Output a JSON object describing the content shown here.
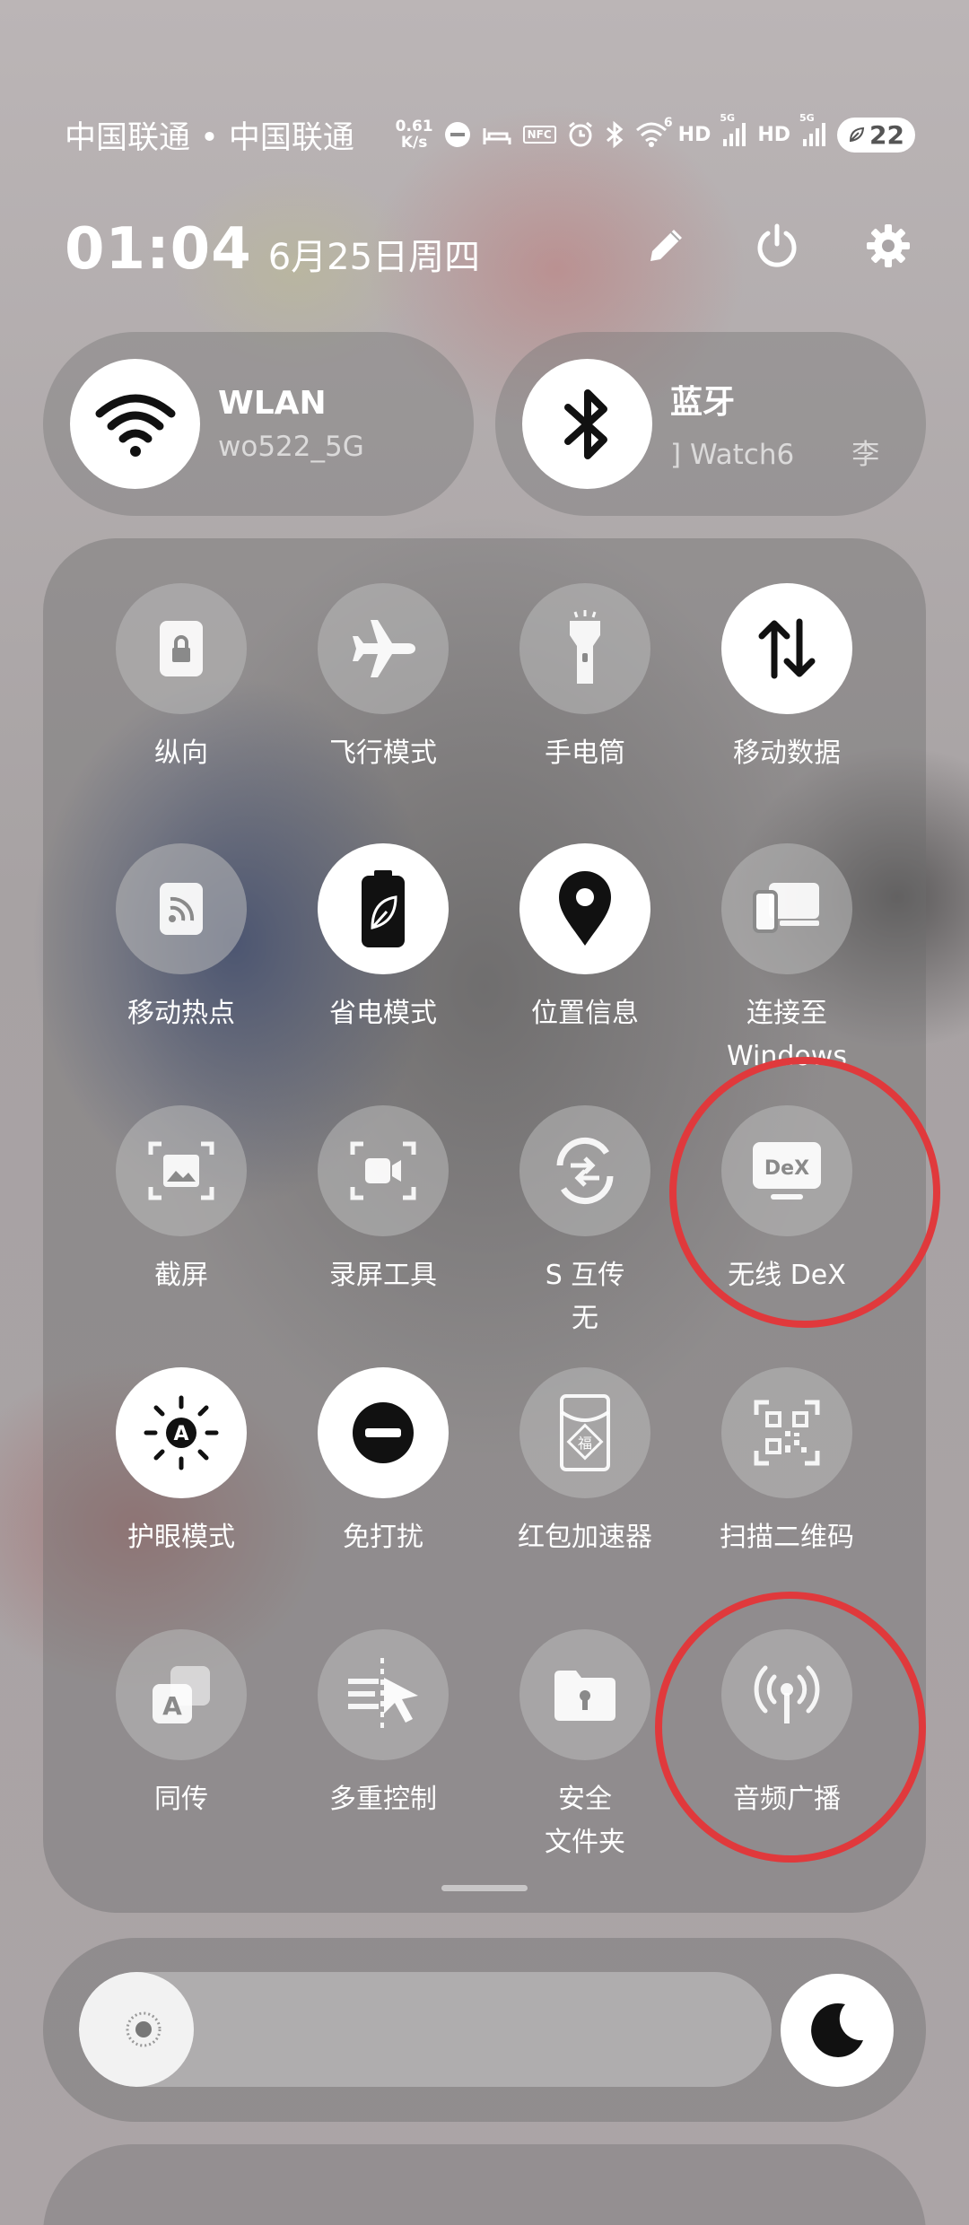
{
  "status_bar": {
    "carriers": "中国联通 • 中国联通",
    "speed_value": "0.61",
    "speed_unit": "K/s",
    "nfc_label": "NFC",
    "hd1": "HD",
    "hd2": "HD",
    "net1": "5G",
    "net2": "5G",
    "wifi_badge": "6",
    "battery": "22"
  },
  "header": {
    "time": "01:04",
    "date": "6月25日周四"
  },
  "wlan": {
    "title": "WLAN",
    "subtitle": "wo522_5G"
  },
  "bluetooth": {
    "title": "蓝牙",
    "subtitle": "] Watch6",
    "subtitle2": "李"
  },
  "tiles": [
    {
      "label": "纵向",
      "icon": "portrait-lock-icon",
      "active": false
    },
    {
      "label": "飞行模式",
      "icon": "airplane-icon",
      "active": false
    },
    {
      "label": "手电筒",
      "icon": "flashlight-icon",
      "active": false
    },
    {
      "label": "移动数据",
      "icon": "mobile-data-icon",
      "active": true
    },
    {
      "label": "移动热点",
      "icon": "hotspot-icon",
      "active": false
    },
    {
      "label": "省电模式",
      "icon": "power-saving-icon",
      "active": true
    },
    {
      "label": "位置信息",
      "icon": "location-icon",
      "active": true
    },
    {
      "label": "连接至\nWindows",
      "icon": "link-to-windows-icon",
      "active": false
    },
    {
      "label": "截屏",
      "icon": "screenshot-icon",
      "active": false
    },
    {
      "label": "录屏工具",
      "icon": "screen-recorder-icon",
      "active": false
    },
    {
      "label": "S 互传\n无",
      "icon": "quick-share-icon",
      "active": false
    },
    {
      "label": "无线 DeX",
      "icon": "dex-icon",
      "active": false,
      "dex_text": "DeX"
    },
    {
      "label": "护眼模式",
      "icon": "eye-comfort-icon",
      "active": true
    },
    {
      "label": "免打扰",
      "icon": "do-not-disturb-icon",
      "active": true
    },
    {
      "label": "红包加速器",
      "icon": "red-envelope-icon",
      "active": false,
      "glyph": "福"
    },
    {
      "label": "扫描二维码",
      "icon": "qr-scan-icon",
      "active": false
    },
    {
      "label": "同传",
      "icon": "interpreter-icon",
      "active": false
    },
    {
      "label": "多重控制",
      "icon": "multi-control-icon",
      "active": false
    },
    {
      "label": "安全\n文件夹",
      "icon": "secure-folder-icon",
      "active": false
    },
    {
      "label": "音频广播",
      "icon": "audio-broadcast-icon",
      "active": false
    }
  ],
  "brightness": {
    "level": 0.06
  },
  "colors": {
    "highlight_ring": "#e0393c",
    "active_tile": "#ffffff"
  }
}
